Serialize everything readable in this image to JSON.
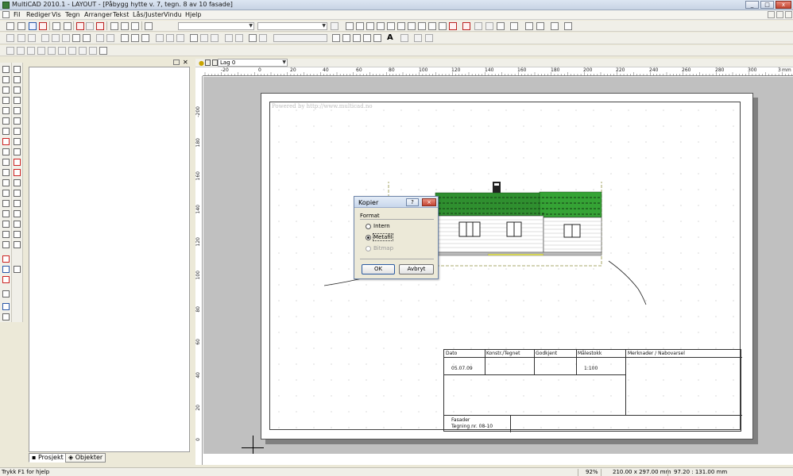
{
  "window": {
    "title": "MultiCAD 2010.1 - LAYOUT - [Påbygg hytte v. 7, tegn. 8 av 10 fasade]",
    "controls": [
      "_",
      "□",
      "x"
    ]
  },
  "menu": {
    "items": [
      "Fil",
      "Rediger",
      "Vis",
      "Tegn",
      "Arranger",
      "Tekst",
      "Lås/Juster",
      "Vindu",
      "Hjelp"
    ]
  },
  "layer": {
    "selected": "Lag 0"
  },
  "ruler": {
    "h_ticks": [
      "-20",
      "0",
      "20",
      "40",
      "60",
      "80",
      "100",
      "120",
      "140",
      "160",
      "180",
      "200",
      "220",
      "240",
      "260",
      "280",
      "300"
    ],
    "h_unit": "mm",
    "h_last": "3",
    "v_ticks": [
      "-200",
      "180",
      "160",
      "140",
      "120",
      "100",
      "80",
      "60",
      "40",
      "20",
      "0"
    ]
  },
  "sheet": {
    "powered_by": "Powered by http://www.multicad.no"
  },
  "title_block": {
    "headers": [
      "Dato",
      "Konstr./Tegnet",
      "Godkjent",
      "Målestokk",
      "Merknader / Nabovarsel"
    ],
    "date": "05.07.09",
    "scale": "1:100",
    "drawing_name": "Fasader",
    "drawing_no": "Tegning nr. 08-10"
  },
  "dialog": {
    "title": "Kopier",
    "help_btn": "?",
    "close_btn": "×",
    "group_label": "Format",
    "options": [
      {
        "label": "Intern",
        "selected": false,
        "enabled": true
      },
      {
        "label": "Metafil",
        "selected": true,
        "enabled": true
      },
      {
        "label": "Bitmap",
        "selected": false,
        "enabled": false
      }
    ],
    "ok": "OK",
    "cancel": "Avbryt"
  },
  "panel": {
    "tabs": [
      {
        "label": "Prosjekt",
        "active": true
      },
      {
        "label": "Objekter",
        "active": false
      }
    ]
  },
  "status": {
    "help": "Trykk F1 for hjelp",
    "zoom": "92%",
    "paper": "210.00 x 297.00 mm",
    "cursor": "97.20 : 131.00 mm"
  },
  "colors": {
    "roof": "#2f8f2f",
    "roof_dark": "#1b4d1b",
    "selection": "#8f8f3f"
  }
}
